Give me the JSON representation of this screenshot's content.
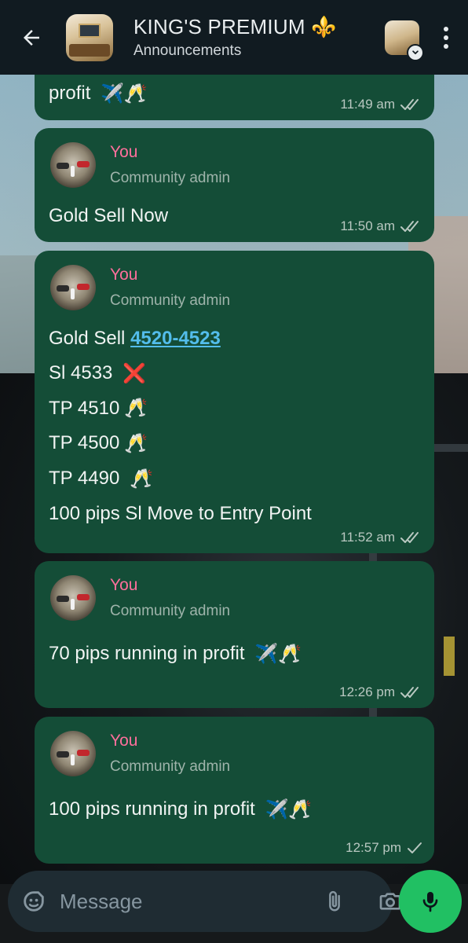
{
  "header": {
    "title": "KING'S PREMIUM ⚜️",
    "subtitle": "Announcements"
  },
  "messages": [
    {
      "partial": true,
      "lines": [
        [
          "profit ",
          "✈️🥂"
        ]
      ],
      "time": "11:49 am",
      "status": "read"
    },
    {
      "sender": "You",
      "role": "Community admin",
      "lines": [
        [
          "Gold Sell Now",
          ""
        ]
      ],
      "time": "11:50 am",
      "status": "read"
    },
    {
      "sender": "You",
      "role": "Community admin",
      "link": "4520-4523",
      "lines": [
        [
          "Gold Sell ",
          ""
        ],
        [
          "Sl 4533 ",
          "❌"
        ],
        [
          "TP 4510",
          "🥂"
        ],
        [
          "TP 4500",
          "🥂"
        ],
        [
          "TP 4490 ",
          "🥂"
        ],
        [
          "100 pips Sl Move to Entry Point",
          ""
        ]
      ],
      "time": "11:52 am",
      "status": "read"
    },
    {
      "sender": "You",
      "role": "Community admin",
      "lines": [
        [
          "70 pips running in profit ",
          "✈️🥂"
        ]
      ],
      "time": "12:26 pm",
      "status": "read"
    },
    {
      "sender": "You",
      "role": "Community admin",
      "lines": [
        [
          "100 pips running in profit ",
          "✈️🥂"
        ]
      ],
      "time": "12:57 pm",
      "status": "sent"
    }
  ],
  "composer": {
    "placeholder": "Message"
  },
  "colors": {
    "bubble": "#144d37",
    "sender_name": "#ff6f9c",
    "link": "#53bdeb",
    "mic": "#21c063",
    "header": "#111b21"
  },
  "icons": [
    "back-arrow-icon",
    "chevron-down-icon",
    "more-vert-icon",
    "sticker-icon",
    "attach-icon",
    "camera-icon",
    "mic-icon",
    "double-check-icon",
    "single-check-icon"
  ]
}
